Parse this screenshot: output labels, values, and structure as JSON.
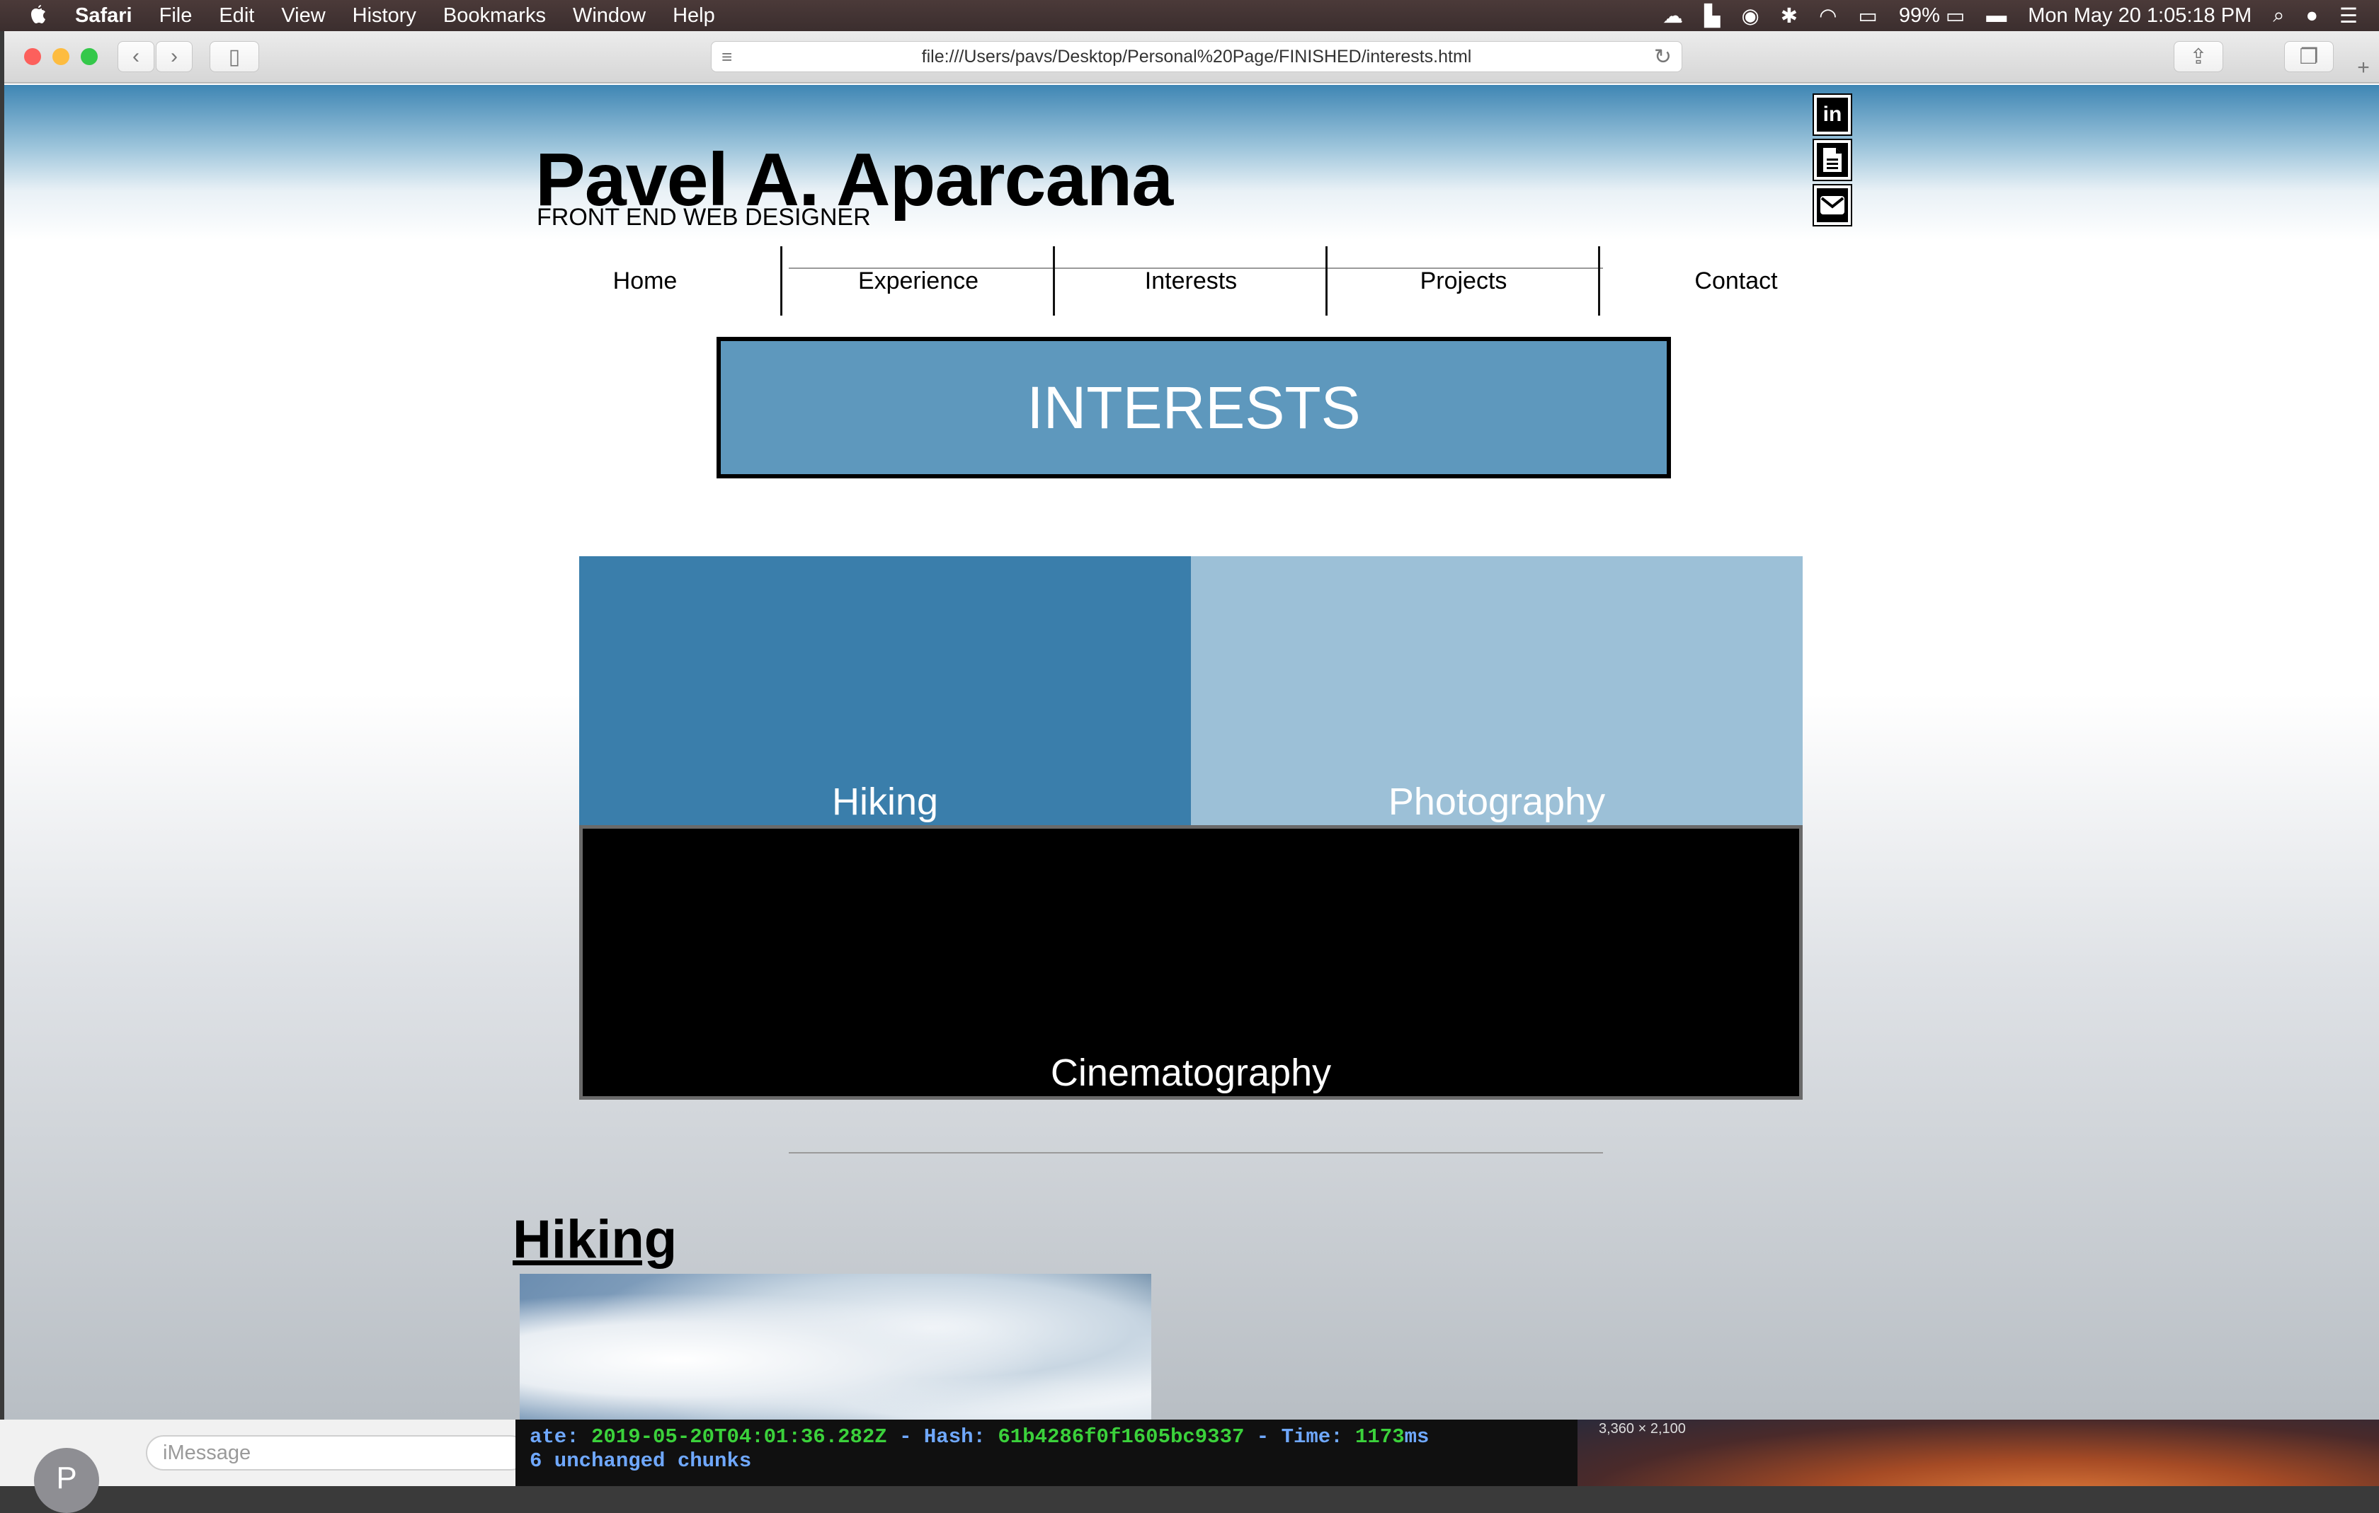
{
  "menubar": {
    "app_name": "Safari",
    "menus": [
      "File",
      "Edit",
      "View",
      "History",
      "Bookmarks",
      "Window",
      "Help"
    ],
    "battery": "99%",
    "clock": "Mon May 20  1:05:18 PM"
  },
  "browser": {
    "url": "file:///Users/pavs/Desktop/Personal%20Page/FINISHED/interests.html"
  },
  "site": {
    "title": "Pavel A. Aparcana",
    "subtitle": "FRONT END WEB DESIGNER",
    "social": [
      "linkedin-icon",
      "document-icon",
      "envelope-icon"
    ],
    "nav": [
      "Home",
      "Experience",
      "Interests",
      "Projects",
      "Contact"
    ],
    "banner": "INTERESTS",
    "tiles": {
      "hiking": "Hiking",
      "photography": "Photography",
      "cinematography": "Cinematography"
    },
    "section_heading": "Hiking",
    "colors": {
      "banner": "#5e98bd",
      "hiking_tile": "#3a7eab",
      "photo_tile": "#9cc0d7",
      "cinema_tile": "#000000"
    }
  },
  "background": {
    "imessage_placeholder": "iMessage",
    "avatar_letter": "P",
    "terminal_line1_a": "ate: ",
    "terminal_line1_b": "2019-05-20T04:01:36.282Z",
    "terminal_line1_c": " - Hash: ",
    "terminal_line1_d": "61b4286f0f1605bc9337",
    "terminal_line1_e": " - Time: ",
    "terminal_line1_f": "1173",
    "terminal_line1_g": "ms",
    "terminal_line2": "6 unchanged chunks",
    "desktop_label": "3,360 × 2,100"
  }
}
